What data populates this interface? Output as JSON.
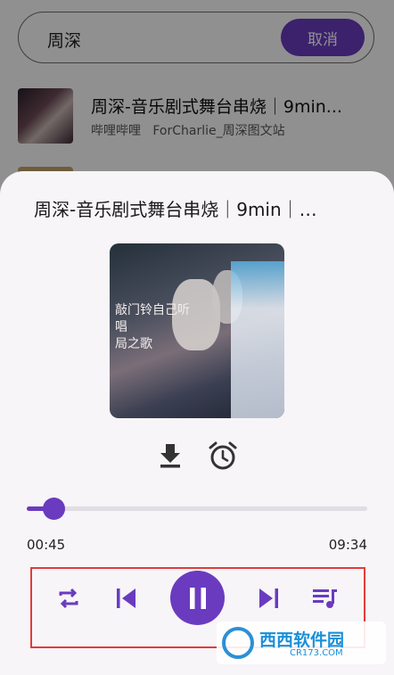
{
  "search": {
    "query": "周深",
    "cancel_label": "取消"
  },
  "results": [
    {
      "title": "周深-音乐剧式舞台串烧｜9min...",
      "platform": "哔哩哔哩",
      "author": "ForCharlie_周深图文站"
    }
  ],
  "player": {
    "title": "周深-音乐剧式舞台串烧｜9min｜…",
    "album_art_text": "敲门铃自己听\n唱\n局之歌",
    "download_icon": "download-icon",
    "alarm_icon": "alarm-clock-icon",
    "elapsed": "00:45",
    "duration": "09:34",
    "progress": 0.078,
    "controls": [
      "repeat-icon",
      "skip-previous-icon",
      "pause-icon",
      "skip-next-icon",
      "playlist-icon"
    ],
    "accent_color": "#6a3bbf",
    "highlight_border_color": "#e23b3b"
  },
  "watermark": {
    "name": "西西软件园",
    "url": "CR173.COM"
  }
}
